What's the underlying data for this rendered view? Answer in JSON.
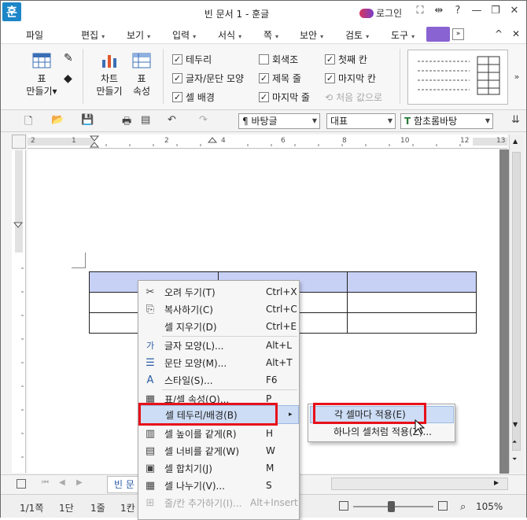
{
  "window": {
    "app_icon": "훈",
    "title": "빈 문서 1 - 훈글",
    "login": "로그인",
    "title_icons": [
      "fullscreen-icon",
      "split-icon",
      "help-icon",
      "minimize-icon",
      "restore-icon",
      "close-icon"
    ],
    "title_glyphs": [
      "⛶",
      "⇹",
      "?",
      "—",
      "❐",
      "✕"
    ]
  },
  "menubar": {
    "items": [
      "파일",
      "편집",
      "보기",
      "입력",
      "서식",
      "쪽",
      "보안",
      "검토",
      "도구"
    ],
    "arrow": "▾",
    "controls": [
      "^",
      "✕"
    ]
  },
  "ribbon": {
    "table_btn": "표\n만들기▾",
    "chart_btn": "차트\n만들기",
    "table_props_btn": "표\n속성",
    "checks": [
      {
        "label": "테두리",
        "checked": true
      },
      {
        "label": "글자/문단 모양",
        "checked": true
      },
      {
        "label": "셀 배경",
        "checked": true
      },
      {
        "label": "회색조",
        "checked": false
      },
      {
        "label": "제목 줄",
        "checked": true
      },
      {
        "label": "마지막 줄",
        "checked": true
      },
      {
        "label": "첫째 칸",
        "checked": true
      },
      {
        "label": "마지막 칸",
        "checked": true
      }
    ],
    "reset_label": "처음 값으로",
    "gallery_arrow": "»"
  },
  "toolbar": {
    "style_combo": "바탕글",
    "style_icon": "paragraph-style-icon",
    "font_group_combo": "대표",
    "font_combo": "함초롬바탕",
    "font_icon": "font-t-icon",
    "font_glyph": "T"
  },
  "ruler": {
    "numbers": [
      "2",
      "1",
      "2",
      "4",
      "6",
      "8",
      "10",
      "12",
      "13"
    ]
  },
  "context_menu": {
    "items": [
      {
        "icon": "scissors-icon",
        "glyph": "✂",
        "label": "오려 두기(T)",
        "shortcut": "Ctrl+X"
      },
      {
        "icon": "copy-icon",
        "glyph": "⎘",
        "label": "복사하기(C)",
        "shortcut": "Ctrl+C"
      },
      {
        "icon": "none",
        "glyph": "",
        "label": "셀 지우기(D)",
        "shortcut": "Ctrl+E"
      },
      {
        "icon": "char-shape-icon",
        "glyph": "가",
        "label": "글자 모양(L)...",
        "shortcut": "Alt+L"
      },
      {
        "icon": "para-shape-icon",
        "glyph": "☰",
        "label": "문단 모양(M)...",
        "shortcut": "Alt+T"
      },
      {
        "icon": "style-icon",
        "glyph": "A",
        "label": "스타일(S)...",
        "shortcut": "F6"
      },
      {
        "icon": "table-props-icon",
        "glyph": "▦",
        "label": "표/셀 속성(Q)...",
        "shortcut": "P"
      },
      {
        "icon": "none",
        "glyph": "",
        "label": "셀 테두리/배경(B)",
        "shortcut": "▸"
      },
      {
        "icon": "equal-height-icon",
        "glyph": "▥",
        "label": "셀 높이를 같게(R)",
        "shortcut": "H"
      },
      {
        "icon": "equal-width-icon",
        "glyph": "▤",
        "label": "셀 너비를 같게(W)",
        "shortcut": "W"
      },
      {
        "icon": "merge-cells-icon",
        "glyph": "▣",
        "label": "셀 합치기(J)",
        "shortcut": "M"
      },
      {
        "icon": "split-cells-icon",
        "glyph": "▦",
        "label": "셀 나누기(V)...",
        "shortcut": "S"
      },
      {
        "icon": "insert-row-icon",
        "glyph": "⊞",
        "label": "줄/칸 추가하기(I)...",
        "shortcut": "Alt+Insert"
      }
    ]
  },
  "submenu": {
    "items": [
      "각 셀마다 적용(E)",
      "하나의 셀처럼 적용(Z)..."
    ]
  },
  "tabbar": {
    "doc_tab": "빈 문"
  },
  "status": {
    "page": "1/1쪽",
    "section": "1단",
    "line": "1줄",
    "col": "1칸",
    "zoom": "105%"
  }
}
